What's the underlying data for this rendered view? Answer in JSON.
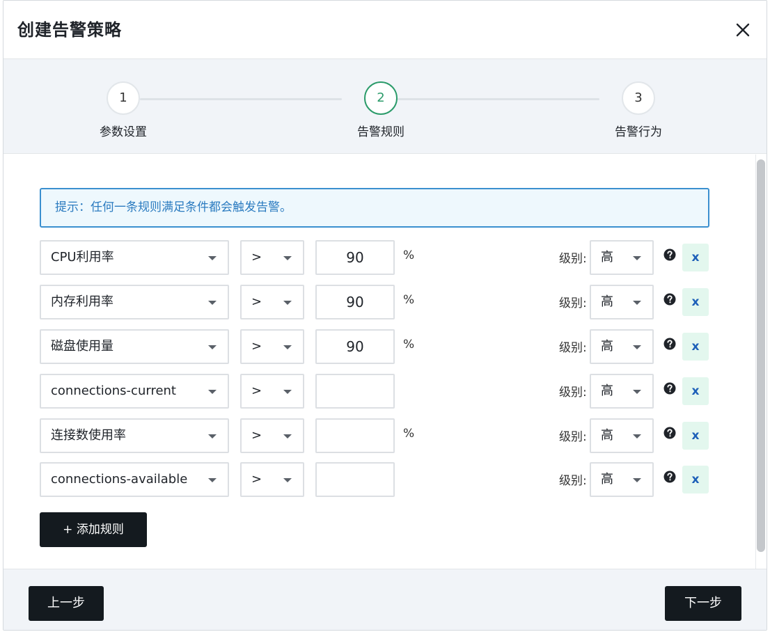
{
  "dialog": {
    "title": "创建告警策略",
    "close_icon": "close-icon"
  },
  "steps": [
    {
      "number": "1",
      "label": "参数设置",
      "active": false
    },
    {
      "number": "2",
      "label": "告警规则",
      "active": true
    },
    {
      "number": "3",
      "label": "告警行为",
      "active": false
    }
  ],
  "hint": "提示：任何一条规则满足条件都会触发告警。",
  "level_label": "级别:",
  "rules": [
    {
      "metric": "CPU利用率",
      "operator": ">",
      "value": "90",
      "unit": "%",
      "level": "高"
    },
    {
      "metric": "内存利用率",
      "operator": ">",
      "value": "90",
      "unit": "%",
      "level": "高"
    },
    {
      "metric": "磁盘使用量",
      "operator": ">",
      "value": "90",
      "unit": "%",
      "level": "高"
    },
    {
      "metric": "connections-current",
      "operator": ">",
      "value": "",
      "unit": "",
      "level": "高"
    },
    {
      "metric": "连接数使用率",
      "operator": ">",
      "value": "",
      "unit": "%",
      "level": "高"
    },
    {
      "metric": "connections-available",
      "operator": ">",
      "value": "",
      "unit": "",
      "level": "高"
    }
  ],
  "delete_label": "x",
  "add_rule_label": "+ 添加规则",
  "footer": {
    "prev_label": "上一步",
    "next_label": "下一步"
  },
  "colors": {
    "accent_green": "#2b9b6a",
    "hint_blue": "#2b7bc0",
    "primary_dark": "#141a1f"
  }
}
